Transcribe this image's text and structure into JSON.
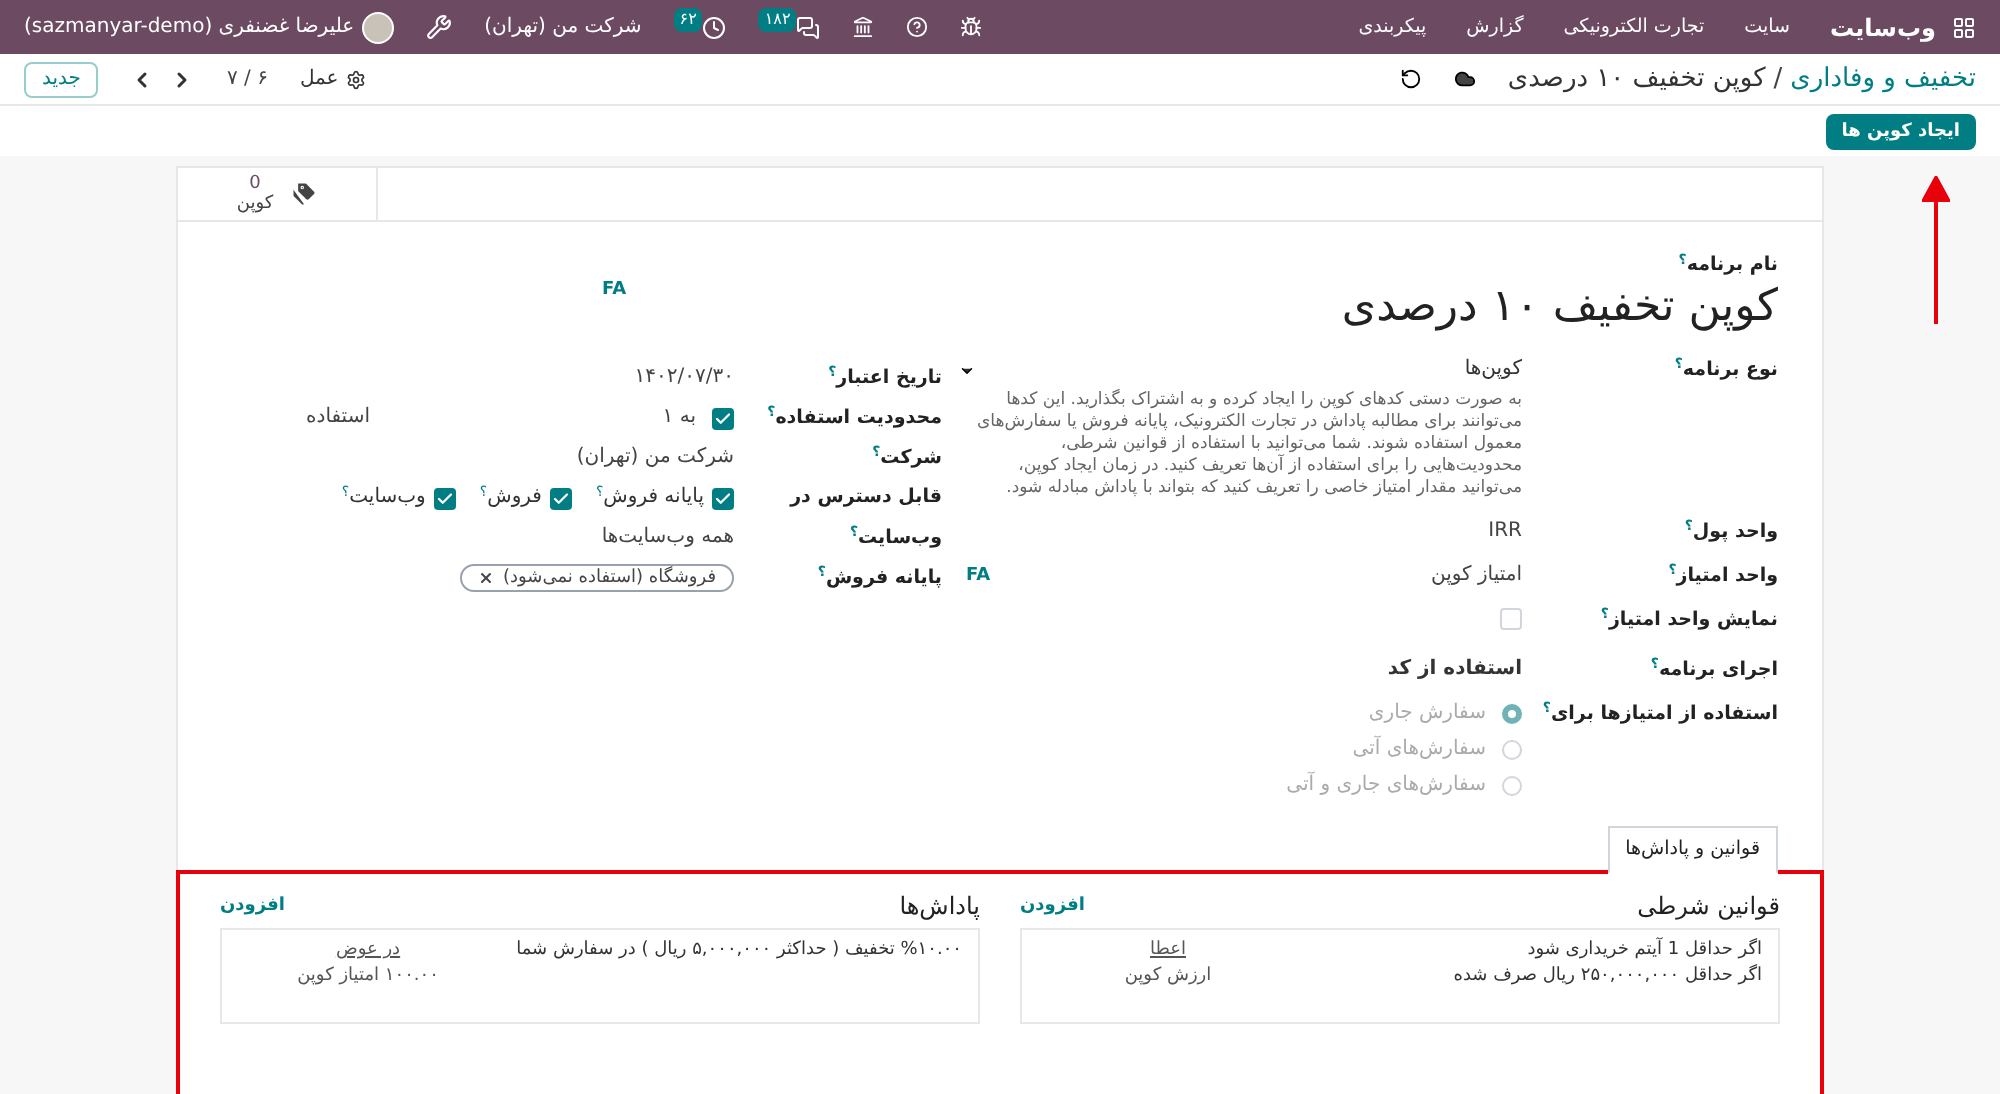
{
  "top_nav": {
    "app": "وب‌سایت",
    "menu": [
      "سایت",
      "تجارت الکترونیکی",
      "گزارش",
      "پیکربندی"
    ],
    "message_count": "۱۸۲",
    "activity_count": "۶۲",
    "company": "شرکت من (تهران)",
    "user": "علیرضا غضنفری (sazmanyar-demo)"
  },
  "control_panel": {
    "breadcrumb": [
      "تخفیف و وفاداری",
      "کوپن تخفیف ۱۰ درصدی"
    ],
    "separator": "/",
    "action": "عمل",
    "pager": "۶ / ۷",
    "new_button": "جدید",
    "generate_button": "ایجاد کوپن ها"
  },
  "smart_button": {
    "count": "0",
    "label": "کوپن"
  },
  "form": {
    "name_label": "نام برنامه$^{؟}$",
    "name": "کوپن تخفیف ۱۰ درصدی",
    "name_translate": "FA",
    "right_fields": [
      {
        "kind": "select",
        "label": "نوع برنامه$^{؟}$",
        "value": "کوپن‌ها",
        "description": "به صورت دستی کدهای کوپن را ایجاد کرده و به اشتراک بگذارید. این کدها می‌توانند برای مطالبه پاداش در تجارت الکترونیک، پایانه فروش یا سفارش‌های معمول استفاده شوند. شما می‌توانید با استفاده از قوانین شرطی، محدودیت‌هایی را برای استفاده از آن‌ها تعریف کنید. در زمان ایجاد کوپن، می‌توانید مقدار امتیاز خاصی را تعریف کنید که بتواند با پاداش مبادله شود."
      },
      {
        "kind": "text",
        "label": "واحد پول$^{؟}$",
        "value": "IRR"
      },
      {
        "kind": "text",
        "label": "واحد امتیاز$^{؟}$",
        "value": "امتیاز کوپن",
        "translate": "FA"
      },
      {
        "kind": "checkbox",
        "label": "نمایش واحد امتیاز$^{؟}$",
        "checked": false
      },
      {
        "kind": "strong",
        "label": "اجرای برنامه$^{؟}$",
        "value": "استفاده از کد"
      },
      {
        "kind": "radio",
        "label": "استفاده از امتیازها برای$^{؟}$",
        "disabled": true,
        "options": [
          {
            "label": "سفارش جاری",
            "selected": true
          },
          {
            "label": "سفارش‌های آتی",
            "selected": false
          },
          {
            "label": "سفارش‌های جاری و آتی",
            "selected": false
          }
        ]
      }
    ],
    "left_fields": [
      {
        "kind": "text",
        "label": "تاریخ اعتبار$^{؟}$",
        "value": "۱۴۰۲/۰۷/۳۰"
      },
      {
        "kind": "limit",
        "label": "محدودیت استفاده$^{؟}$",
        "checked": true,
        "value": "به ۱",
        "suffix": "استفاده"
      },
      {
        "kind": "text",
        "label": "شرکت$^{؟}$",
        "value": "شرکت من (تهران)"
      },
      {
        "kind": "checks",
        "label": "قابل دسترس در",
        "options": [
          {
            "label": "پایانه فروش$^{؟}$",
            "checked": true
          },
          {
            "label": "فروش$^{؟}$",
            "checked": true
          },
          {
            "label": "وب‌سایت$^{؟}$",
            "checked": true
          }
        ]
      },
      {
        "kind": "text",
        "label": "وب‌سایت$^{؟}$",
        "value": "همه وب‌سایت‌ها"
      },
      {
        "kind": "tags",
        "label": "پایانه فروش$^{؟}$",
        "tags": [
          "فروشگاه (استفاده نمی‌شود)"
        ]
      }
    ]
  },
  "tabs": [
    {
      "label": "قوانین و پاداش‌ها",
      "selected": true
    }
  ],
  "sections": [
    {
      "title": "قوانین شرطی",
      "add": "افزودن",
      "lines": [
        "اگر حداقل 1 آیتم خریداری شود",
        "اگر حداقل ۲۵۰,۰۰۰,۰۰۰ ریال صرف شده"
      ],
      "side_link": "اعطا",
      "side_text": "ارزش کوپن"
    },
    {
      "title": "پاداش‌ها",
      "add": "افزودن",
      "lines": [
        "%۱۰.۰۰ تخفیف ( حداکثر ۵,۰۰۰,۰۰۰ ریال ) در سفارش شما"
      ],
      "side_link": "در عوض",
      "side_text": "۱۰۰.۰۰ امتیاز کوپن"
    }
  ],
  "annotations": {
    "highlight_frame": true,
    "arrow": true
  }
}
